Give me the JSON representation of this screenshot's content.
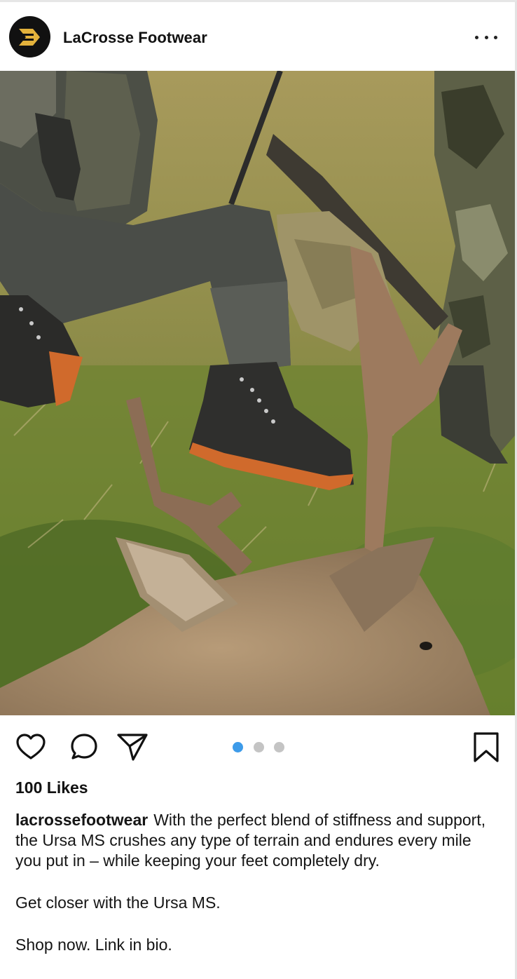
{
  "post": {
    "account_name": "LaCrosse Footwear",
    "avatar_icon": "lacrosse-logo-icon",
    "more_icon": "more-dots-icon",
    "image_alt": "Hunters resting in grass beside a harvested deer",
    "carousel": {
      "count": 3,
      "active_index": 0
    },
    "actions": {
      "like_icon": "heart-icon",
      "comment_icon": "comment-icon",
      "share_icon": "send-icon",
      "save_icon": "bookmark-icon"
    },
    "likes_text": "100 Likes",
    "caption": {
      "username": "lacrossefootwear",
      "paragraph_1": "With the perfect blend of stiffness and support, the Ursa MS crushes any type of terrain and endures every mile you put in – while keeping your feet completely dry.",
      "paragraph_2": "Get closer with the Ursa MS.",
      "paragraph_3": "Shop now. Link in bio."
    }
  },
  "colors": {
    "accent_dot": "#3d9be9",
    "inactive_dot": "#c4c4c4",
    "logo_gold": "#e3b23c",
    "text": "#111111"
  }
}
